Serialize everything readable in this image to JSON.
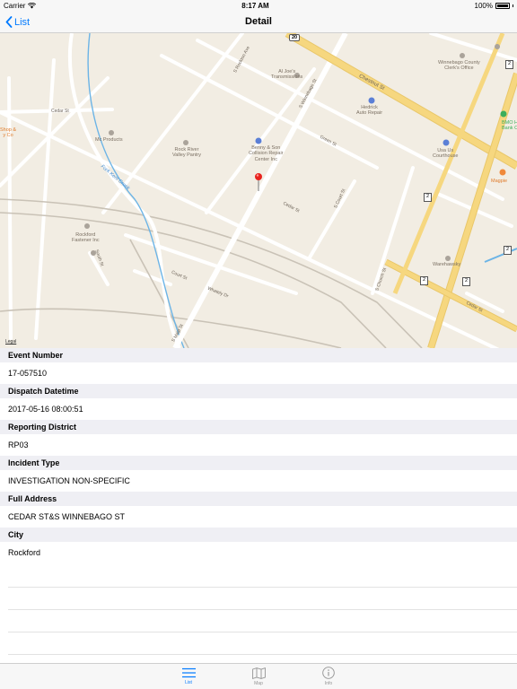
{
  "status_bar": {
    "carrier": "Carrier",
    "time": "8:17 AM",
    "battery": "100%"
  },
  "nav": {
    "back_label": "List",
    "title": "Detail"
  },
  "map": {
    "legal": "Legal",
    "labels": {
      "aljoes": "Al Joe's\nTransmissions",
      "hedrick": "Hedrick\nAuto Repair",
      "winnebago_clerk": "Winnebago County\nClerk's Office",
      "bmo": "BMO H\nBank C",
      "rockriver": "Rock River\nValley Pantry",
      "mcproducts": "Mc Products",
      "bennyson": "Benny & Son\nCollision Repair\nCenter Inc",
      "courthouse": "Usa Us\nCourthouse",
      "magpie": "Magpie",
      "shop": "Shop &\ny Co",
      "forkkent": "Fork Kent Creek",
      "rockford_fastener": "Rockford\nFastener Inc",
      "warehawsky": "Warehawsky",
      "chestnut": "Chestnut St",
      "cedar": "Cedar St",
      "cedar2": "Cedar St",
      "cedar3": "Cedar St",
      "green": "Green St",
      "court": "Court St",
      "whately": "Whately Dr",
      "winnebago_st": "S Winnebago St",
      "rockton": "S Rockton Ave",
      "church": "S Church St",
      "court_st": "S Court St",
      "main": "S Main St",
      "south": "South St",
      "route20": "20",
      "shield2a": "2",
      "shield2b": "2",
      "shield2c": "2",
      "shield2d": "2",
      "shield2e": "2"
    }
  },
  "details": [
    {
      "label": "Event Number",
      "value": "17-057510"
    },
    {
      "label": "Dispatch Datetime",
      "value": "2017-05-16 08:00:51"
    },
    {
      "label": "Reporting District",
      "value": "RP03"
    },
    {
      "label": "Incident Type",
      "value": "INVESTIGATION NON-SPECIFIC"
    },
    {
      "label": "Full Address",
      "value": "CEDAR ST&S WINNEBAGO ST"
    },
    {
      "label": "City",
      "value": "Rockford"
    }
  ],
  "tabs": [
    {
      "label": "List",
      "icon": "list-icon",
      "active": true
    },
    {
      "label": "Map",
      "icon": "map-icon",
      "active": false
    },
    {
      "label": "Info",
      "icon": "info-icon",
      "active": false
    }
  ],
  "colors": {
    "accent": "#007aff",
    "map_bg": "#f2ede3",
    "highway": "#f6d77f",
    "water": "#6cb4e6",
    "section_bg": "#efeff4"
  }
}
